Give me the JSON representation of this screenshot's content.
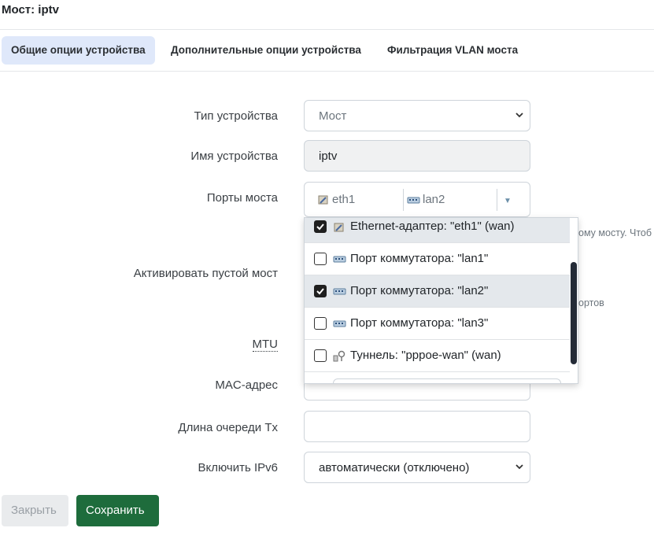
{
  "header": {
    "title": "Мост: iptv"
  },
  "tabs": [
    {
      "label": "Общие опции устройства",
      "active": true
    },
    {
      "label": "Дополнительные опции устройства",
      "active": false
    },
    {
      "label": "Фильтрация VLAN моста",
      "active": false
    }
  ],
  "form": {
    "device_type": {
      "label": "Тип устройства",
      "value": "Мост"
    },
    "device_name": {
      "label": "Имя устройства",
      "value": "iptv"
    },
    "bridge_ports": {
      "label": "Порты моста",
      "selected": [
        {
          "label": "eth1",
          "icon": "ethernet-adapter-icon"
        },
        {
          "label": "lan2",
          "icon": "switch-port-icon"
        }
      ],
      "hint": "ому мосту. Чтоб",
      "options": [
        {
          "label": "Ethernet-адаптер: \"eth1\" (wan)",
          "checked": true,
          "icon": "ethernet-adapter-icon"
        },
        {
          "label": "Порт коммутатора: \"lan1\"",
          "checked": false,
          "icon": "switch-port-icon"
        },
        {
          "label": "Порт коммутатора: \"lan2\"",
          "checked": true,
          "icon": "switch-port-icon"
        },
        {
          "label": "Порт коммутатора: \"lan3\"",
          "checked": false,
          "icon": "switch-port-icon"
        },
        {
          "label": "Туннель: \"pppoe-wan\" (wan)",
          "checked": false,
          "icon": "tunnel-icon"
        }
      ]
    },
    "empty_bridge": {
      "label": "Активировать пустой мост",
      "hint": "ортов"
    },
    "mtu": {
      "label": "MTU"
    },
    "mac": {
      "label": "MAC-адрес"
    },
    "txqueuelen": {
      "label": "Длина очереди Tx",
      "value": ""
    },
    "ipv6": {
      "label": "Включить IPv6",
      "value": "автоматически (отключено)"
    }
  },
  "buttons": {
    "close": "Закрыть",
    "save": "Сохранить"
  },
  "colors": {
    "primary": "#1e6c3c",
    "active_tab": "#dfe8fa"
  }
}
